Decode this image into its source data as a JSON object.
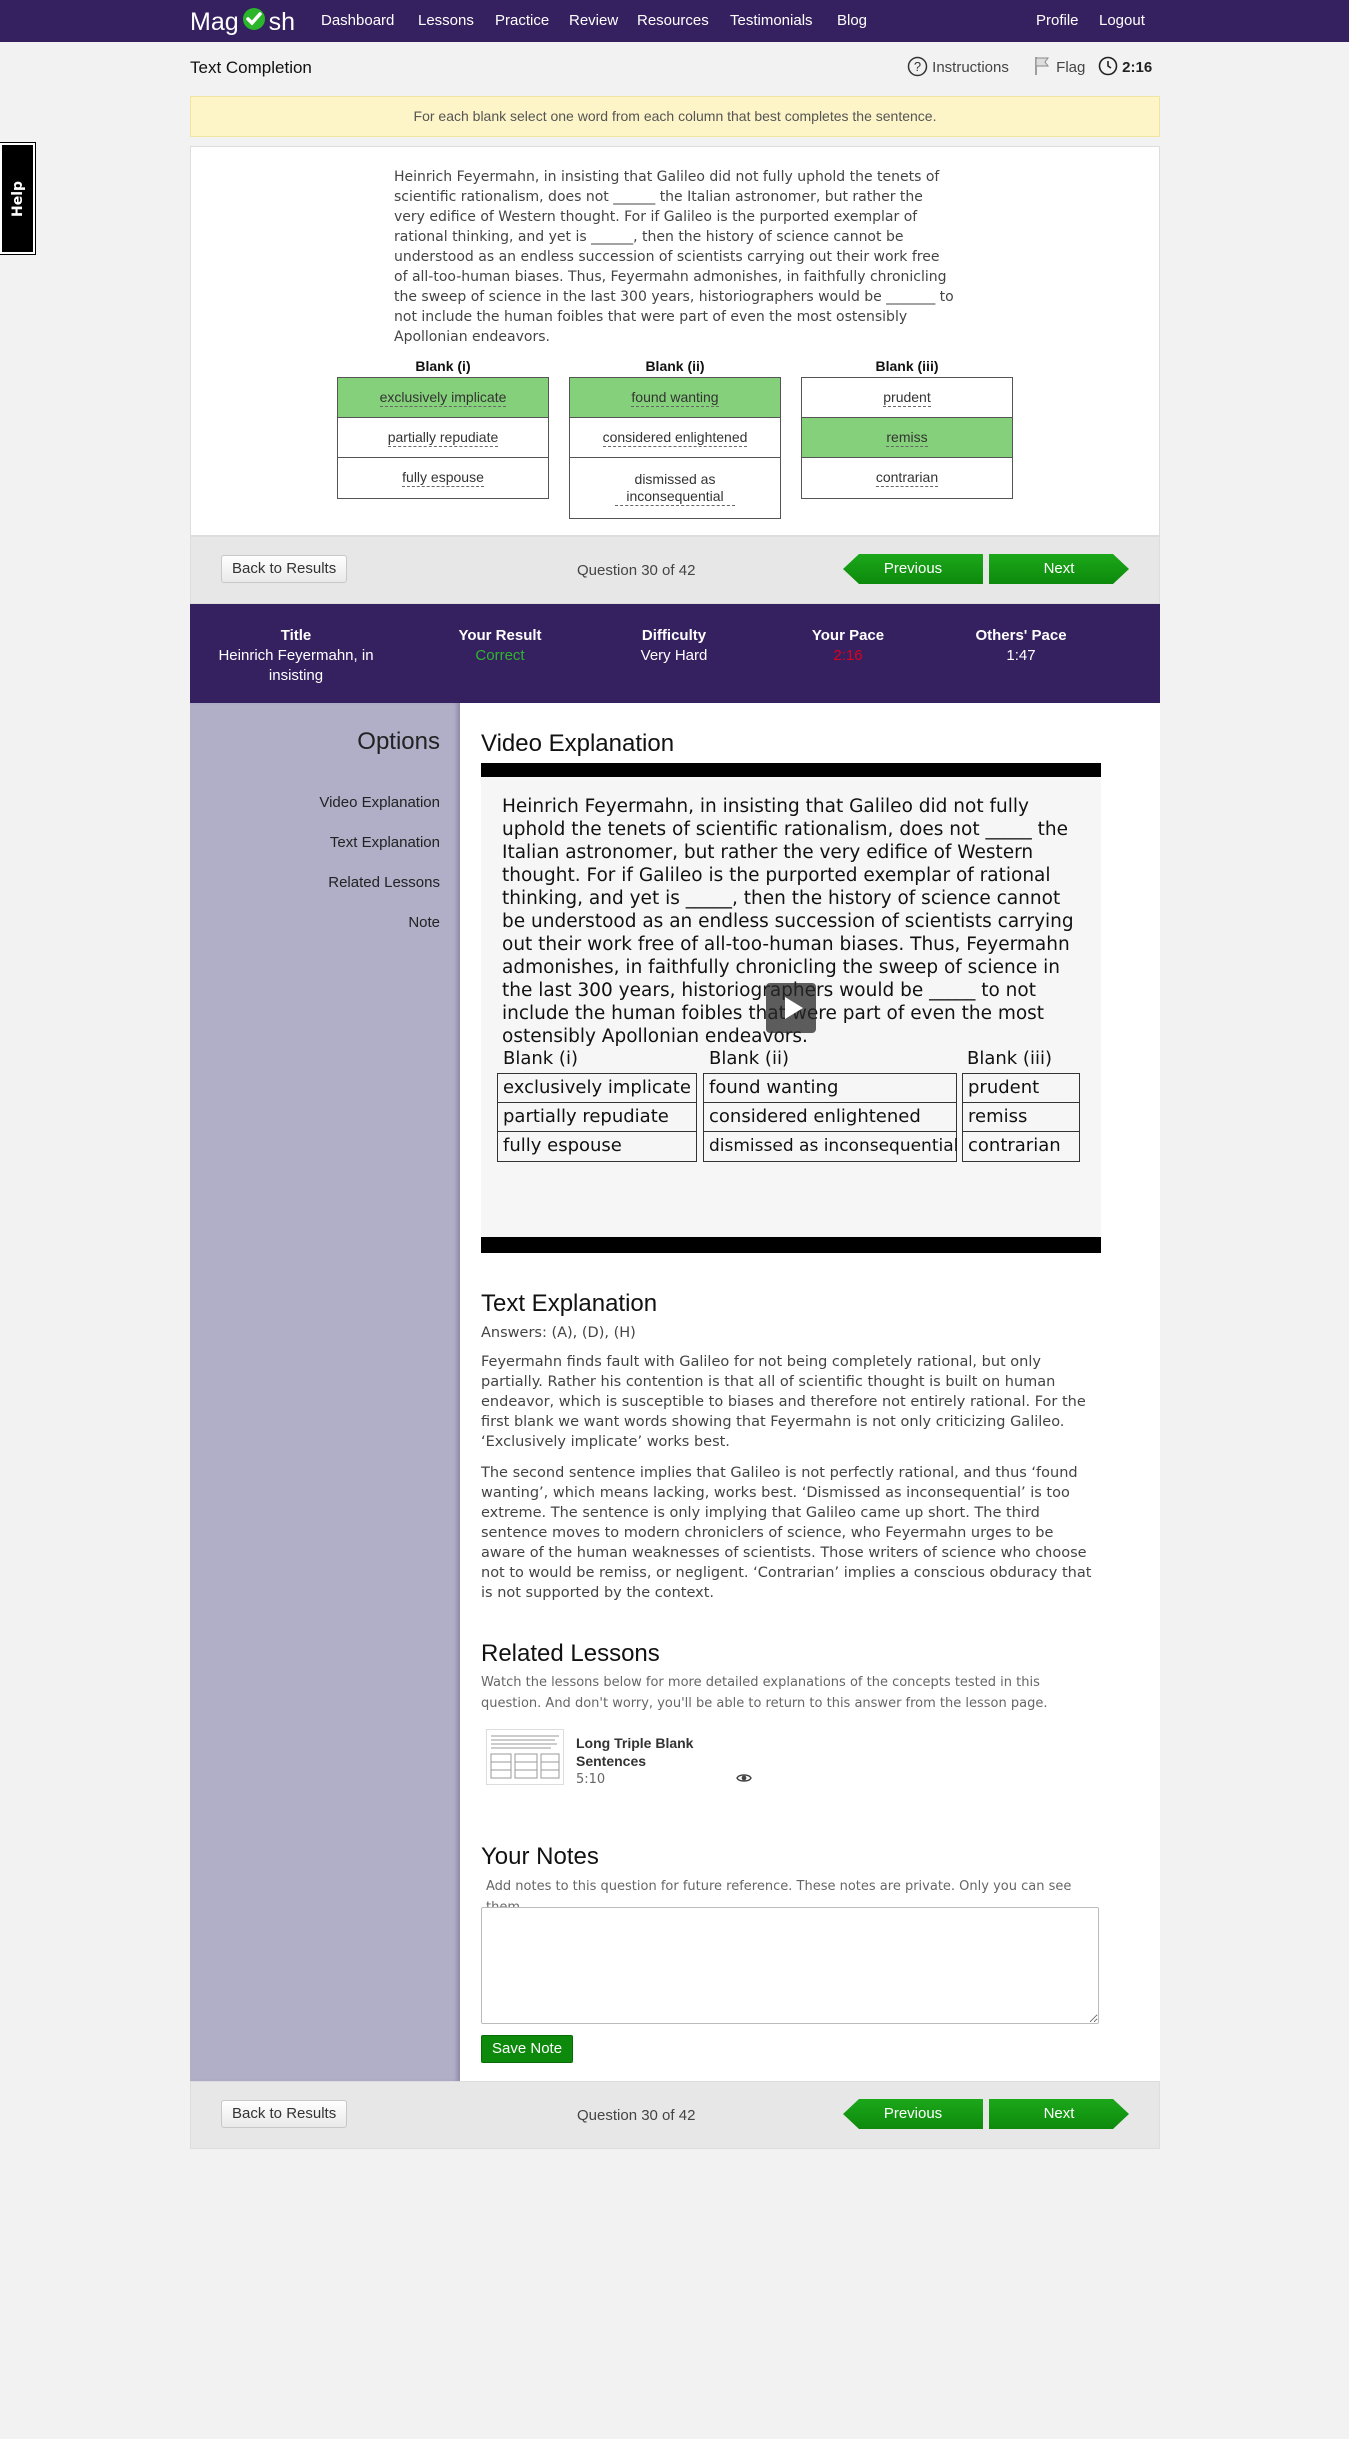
{
  "nav": {
    "brand": "Magoosh",
    "links": [
      "Dashboard",
      "Lessons",
      "Practice",
      "Review",
      "Resources",
      "Testimonials",
      "Blog"
    ],
    "right_links": [
      "Profile",
      "Logout"
    ]
  },
  "question_header": {
    "title": "Text Completion",
    "instructions_label": "Instructions",
    "flag_label": "Flag",
    "timer": "2:16"
  },
  "help_tab": "Help",
  "instruction_banner": "For each blank select one word from each column that best completes the sentence.",
  "passage": "Heinrich Feyermahn, in insisting that Galileo did not fully uphold the tenets of scientific rationalism, does not ______ the Italian astronomer, but rather the very edifice of Western thought. For if Galileo is the purported exemplar of rational thinking, and yet is ______, then the history of science cannot be understood as an endless succession of scientists carrying out their work free of all-too-human biases. Thus, Feyermahn admonishes, in faithfully chronicling the sweep of science in the last 300 years, historiographers would be _______ to not include the human foibles that were part of even the most ostensibly Apollonian endeavors.",
  "blanks": [
    {
      "heading": "Blank (i)",
      "options": [
        "exclusively implicate",
        "partially repudiate",
        "fully espouse"
      ],
      "selected": 0
    },
    {
      "heading": "Blank (ii)",
      "options": [
        "found wanting",
        "considered enlightened",
        "dismissed as inconsequential"
      ],
      "selected": 0
    },
    {
      "heading": "Blank (iii)",
      "options": [
        "prudent",
        "remiss",
        "contrarian"
      ],
      "selected": 1
    }
  ],
  "pager": {
    "back_label": "Back to Results",
    "counter": "Question 30 of 42",
    "previous_label": "Previous",
    "next_label": "Next"
  },
  "stats": {
    "title_label": "Title",
    "title_value": "Heinrich Feyermahn, in insisting",
    "result_label": "Your Result",
    "result_value": "Correct",
    "difficulty_label": "Difficulty",
    "difficulty_value": "Very Hard",
    "pace_label": "Your Pace",
    "pace_value": "2:16",
    "others_label": "Others' Pace",
    "others_value": "1:47",
    "colors": {
      "correct": "#2fb52c",
      "pace": "#e0001b"
    }
  },
  "options_sidebar": {
    "title": "Options",
    "items": [
      "Video Explanation",
      "Text Explanation",
      "Related Lessons",
      "Note"
    ]
  },
  "video_explanation": {
    "heading": "Video Explanation",
    "frame_passage": "Heinrich Feyermahn, in insisting that Galileo did not fully uphold the tenets of scientific rationalism, does not _____ the Italian astronomer, but rather the very edifice of Western thought.  For if Galileo is the purported exemplar of rational thinking, and yet is _____, then the history of science cannot be understood as an endless succession of scientists carrying out their work free of all-too-human biases. Thus, Feyermahn admonishes, in faithfully chronicling the sweep of science in the last 300 years, historiographers would be _____ to not include the human foibles that were part of even the most ostensibly Apollonian endeavors.",
    "frame_blanks": [
      {
        "heading": "Blank (i)",
        "options": [
          "exclusively implicate",
          "partially repudiate",
          "fully espouse"
        ]
      },
      {
        "heading": "Blank (ii)",
        "options": [
          "found wanting",
          "considered enlightened",
          "dismissed as inconsequential"
        ]
      },
      {
        "heading": "Blank (iii)",
        "options": [
          "prudent",
          "remiss",
          "contrarian"
        ]
      }
    ]
  },
  "text_explanation": {
    "heading": "Text Explanation",
    "answers": "Answers: (A), (D), (H)",
    "paragraphs": [
      "Feyermahn finds fault with Galileo for not being completely rational, but only partially. Rather his contention is that all of scientific thought is built on human endeavor, which is susceptible to biases and therefore not entirely rational. For the first blank we want words showing that Feyermahn is not only criticizing Galileo. ‘Exclusively implicate’ works best.",
      "The second sentence implies that Galileo is not perfectly rational, and thus ‘found wanting’, which means lacking, works best. ‘Dismissed as inconsequential’ is too extreme. The sentence is only implying that Galileo came up short. The third sentence moves to modern chroniclers of science, who Feyermahn urges to be aware of the human weaknesses of scientists. Those writers of science who choose not to would be remiss, or negligent. ‘Contrarian’ implies a conscious obduracy that is not supported by the context."
    ]
  },
  "related_lessons": {
    "heading": "Related Lessons",
    "intro": "Watch the lessons below for more detailed explanations of the concepts tested in this question. And don't worry, you'll be able to return to this answer from the lesson page.",
    "lessons": [
      {
        "title": "Long Triple Blank Sentences",
        "duration": "5:10",
        "icon": "eye-icon"
      }
    ]
  },
  "notes": {
    "heading": "Your Notes",
    "hint": "Add notes to this question for future reference. These notes are private. Only you can see them.",
    "value": "",
    "save_label": "Save Note"
  }
}
